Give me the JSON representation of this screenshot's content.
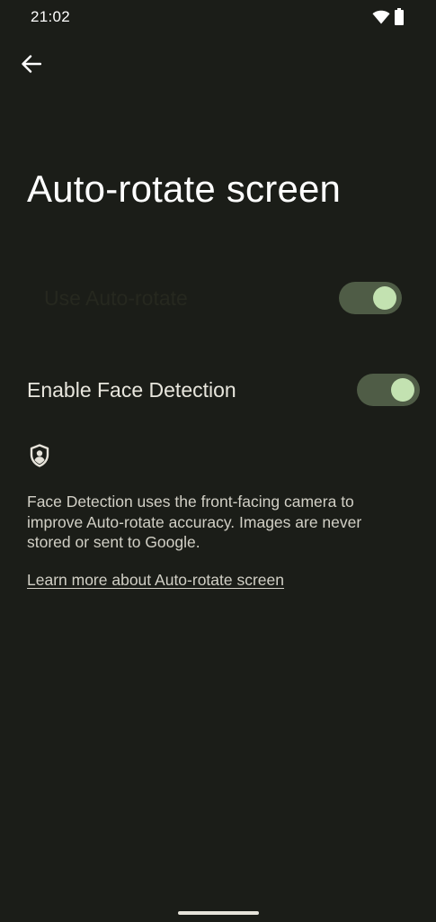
{
  "status_bar": {
    "time": "21:02",
    "wifi_icon": "wifi-icon",
    "battery_icon": "battery-icon"
  },
  "header": {
    "back_icon": "arrow-back-icon",
    "title": "Auto-rotate screen"
  },
  "settings": {
    "use_auto_rotate": {
      "label": "Use Auto-rotate",
      "enabled": true
    },
    "face_detection": {
      "label": "Enable Face Detection",
      "enabled": true
    }
  },
  "info": {
    "icon": "shield-person-icon",
    "description": "Face Detection uses the front-facing camera to improve Auto-rotate accuracy. Images are never stored or sent to Google.",
    "link_label": "Learn more about Auto-rotate screen"
  },
  "colors": {
    "background": "#1b1d18",
    "switch_track": "#4f5c46",
    "switch_thumb": "#c3e2b1",
    "text_primary": "#ffffff"
  }
}
